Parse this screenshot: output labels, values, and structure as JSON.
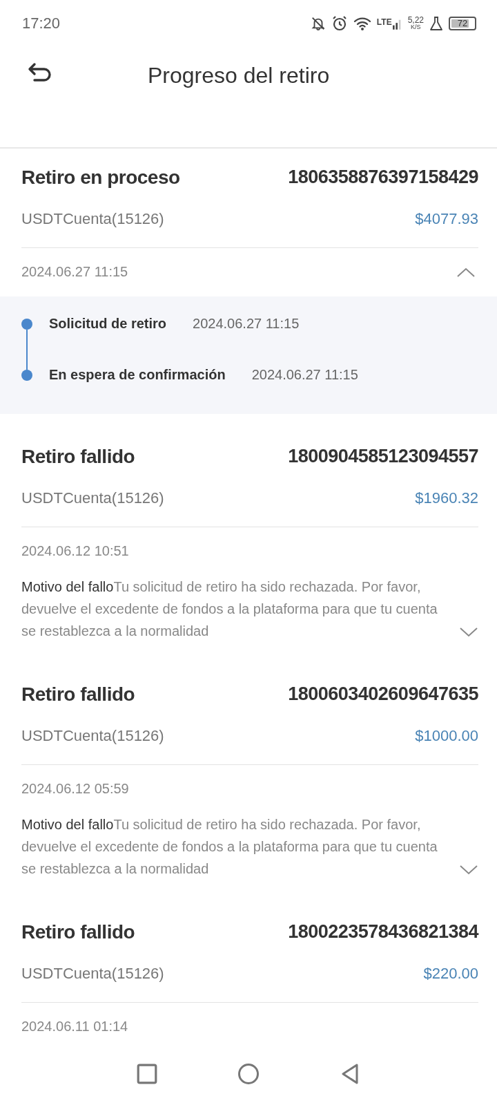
{
  "status_bar": {
    "time": "17:20",
    "network": "LTE",
    "speed": "5,22",
    "speed_unit": "K/S",
    "battery": "72"
  },
  "header": {
    "title": "Progreso del retiro"
  },
  "records": [
    {
      "kind": "in_progress",
      "status": "Retiro en proceso",
      "order_id": "1806358876397158429",
      "account": "USDTCuenta(15126)",
      "amount": "$4077.93",
      "date": "2024.06.27 11:15",
      "expanded": true,
      "steps": [
        {
          "label": "Solicitud de retiro",
          "time": "2024.06.27 11:15"
        },
        {
          "label": "En espera de confirmación",
          "time": "2024.06.27 11:15"
        }
      ]
    },
    {
      "kind": "failed",
      "status": "Retiro fallido",
      "order_id": "1800904585123094557",
      "account": "USDTCuenta(15126)",
      "amount": "$1960.32",
      "date": "2024.06.12 10:51",
      "expanded": false,
      "reason": "**Motivo del fallo**Tu solicitud de retiro ha sido rechazada. Por favor, devuelve el excedente de fondos a la plataforma para que tu cuenta se restablezca a la normalidad"
    },
    {
      "kind": "failed",
      "status": "Retiro fallido",
      "order_id": "1800603402609647635",
      "account": "USDTCuenta(15126)",
      "amount": "$1000.00",
      "date": "2024.06.12 05:59",
      "expanded": false,
      "reason": "**Motivo del fallo**Tu solicitud de retiro ha sido rechazada. Por favor, devuelve el excedente de fondos a la plataforma para que tu cuenta se restablezca a la normalidad"
    },
    {
      "kind": "failed",
      "status": "Retiro fallido",
      "order_id": "1800223578436821384",
      "account": "USDTCuenta(15126)",
      "amount": "$220.00",
      "date": "2024.06.11 01:14"
    }
  ]
}
